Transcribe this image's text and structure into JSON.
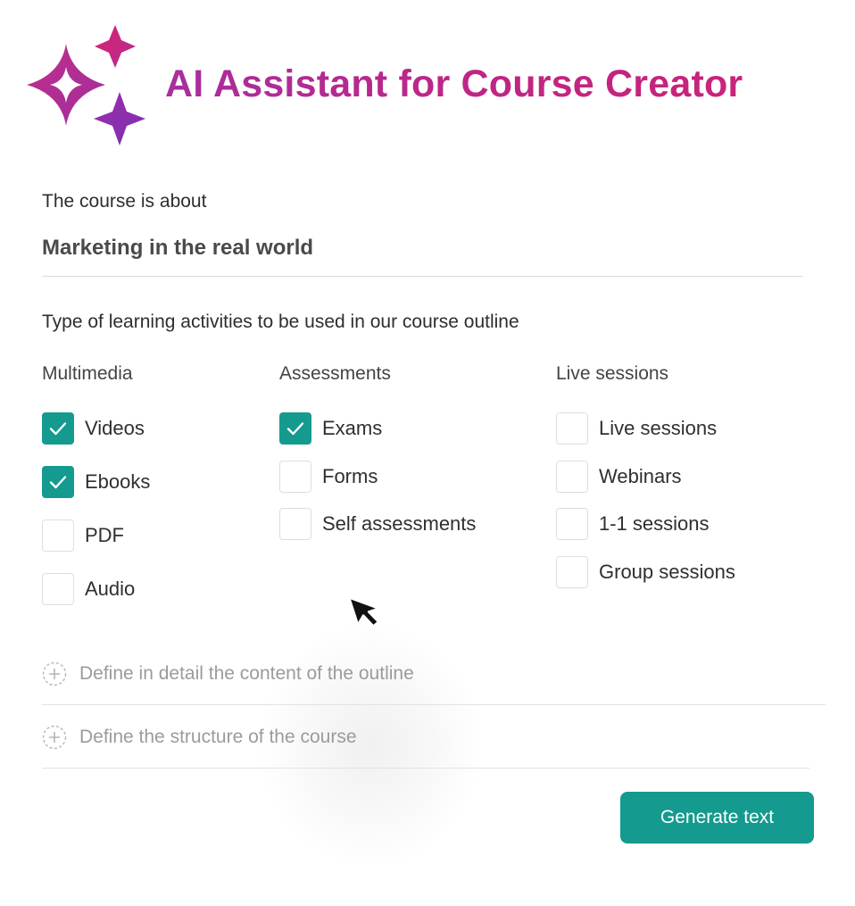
{
  "header": {
    "title": "AI Assistant for Course Creator",
    "logo_icon": "sparkle-stars-icon",
    "brand_colors": [
      "#d8246e",
      "#b72a93",
      "#8e2eb0"
    ]
  },
  "topic": {
    "label": "The course is about",
    "value": "Marketing in the real world"
  },
  "activities": {
    "label": "Type of learning activities to be used in our course outline",
    "columns": [
      {
        "title": "Multimedia",
        "options": [
          {
            "label": "Videos",
            "checked": true
          },
          {
            "label": "Ebooks",
            "checked": true
          },
          {
            "label": "PDF",
            "checked": false
          },
          {
            "label": "Audio",
            "checked": false
          }
        ]
      },
      {
        "title": "Assessments",
        "options": [
          {
            "label": "Exams",
            "checked": true
          },
          {
            "label": "Forms",
            "checked": false
          },
          {
            "label": "Self assessments",
            "checked": false
          }
        ]
      },
      {
        "title": "Live sessions",
        "options": [
          {
            "label": "Live sessions",
            "checked": false
          },
          {
            "label": "Webinars",
            "checked": false
          },
          {
            "label": "1-1 sessions",
            "checked": false
          },
          {
            "label": "Group sessions",
            "checked": false
          }
        ]
      }
    ]
  },
  "expandables": [
    {
      "label": "Define in detail the content of the outline",
      "icon": "plus-circle-icon"
    },
    {
      "label": "Define the structure of the course",
      "icon": "plus-circle-icon"
    }
  ],
  "actions": {
    "generate_label": "Generate text"
  },
  "colors": {
    "accent": "#149a8e",
    "checkbox_border": "#dedede"
  }
}
